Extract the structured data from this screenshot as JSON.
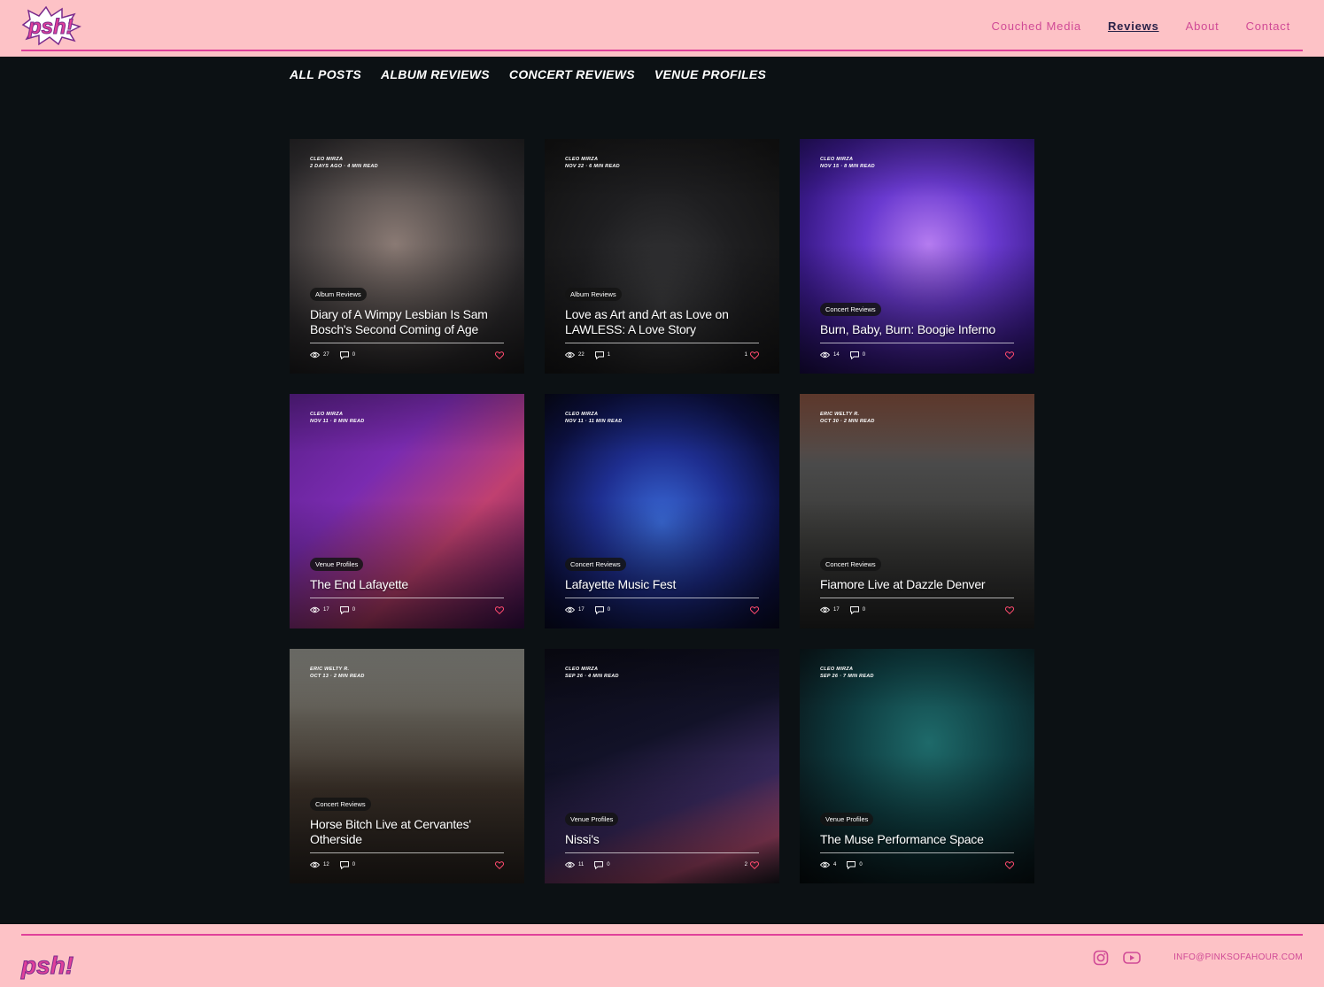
{
  "header": {
    "logo_text": "psh!",
    "nav": [
      {
        "label": "Couched Media"
      },
      {
        "label": "Reviews"
      },
      {
        "label": "About"
      },
      {
        "label": "Contact"
      }
    ]
  },
  "categories": [
    "All Posts",
    "Album Reviews",
    "Concert Reviews",
    "Venue Profiles"
  ],
  "posts": [
    {
      "author": "Cleo Mirza",
      "date": "2 days ago",
      "read": "4 min read",
      "tag": "Album Reviews",
      "title": "Diary of A Wimpy Lesbian Is Sam Bosch's Second Coming of Age",
      "views": "27",
      "comments": "0",
      "likes": ""
    },
    {
      "author": "Cleo Mirza",
      "date": "Nov 22",
      "read": "6 min read",
      "tag": "Album Reviews",
      "title": "Love as Art and Art as Love on LAWLESS: A Love Story",
      "views": "22",
      "comments": "1",
      "likes": "1"
    },
    {
      "author": "Cleo Mirza",
      "date": "Nov 15",
      "read": "8 min read",
      "tag": "Concert Reviews",
      "title": "Burn, Baby, Burn: Boogie Inferno",
      "views": "14",
      "comments": "0",
      "likes": ""
    },
    {
      "author": "Cleo Mirza",
      "date": "Nov 11",
      "read": "8 min read",
      "tag": "Venue Profiles",
      "title": "The End Lafayette",
      "views": "17",
      "comments": "0",
      "likes": ""
    },
    {
      "author": "Cleo Mirza",
      "date": "Nov 11",
      "read": "11 min read",
      "tag": "Concert Reviews",
      "title": "Lafayette Music Fest",
      "views": "17",
      "comments": "0",
      "likes": ""
    },
    {
      "author": "Eric Welty R.",
      "date": "Oct 30",
      "read": "2 min read",
      "tag": "Concert Reviews",
      "title": "Fiamore Live at Dazzle Denver",
      "views": "17",
      "comments": "0",
      "likes": ""
    },
    {
      "author": "Eric Welty R.",
      "date": "Oct 13",
      "read": "2 min read",
      "tag": "Concert Reviews",
      "title": "Horse Bitch Live at Cervantes' Otherside",
      "views": "12",
      "comments": "0",
      "likes": ""
    },
    {
      "author": "Cleo Mirza",
      "date": "Sep 26",
      "read": "4 min read",
      "tag": "Venue Profiles",
      "title": "Nissi's",
      "views": "11",
      "comments": "0",
      "likes": "2"
    },
    {
      "author": "Cleo Mirza",
      "date": "Sep 26",
      "read": "7 min read",
      "tag": "Venue Profiles",
      "title": "The Muse Performance Space",
      "views": "4",
      "comments": "0",
      "likes": ""
    }
  ],
  "footer": {
    "logo_text": "psh!",
    "email": "INFO@PINKSOFAHOUR.COM",
    "social_icons": [
      "instagram-icon",
      "youtube-icon"
    ]
  },
  "colors": {
    "header_bg": "#fdc2c6",
    "accent": "#e0409a",
    "page_bg": "#0c1114"
  }
}
